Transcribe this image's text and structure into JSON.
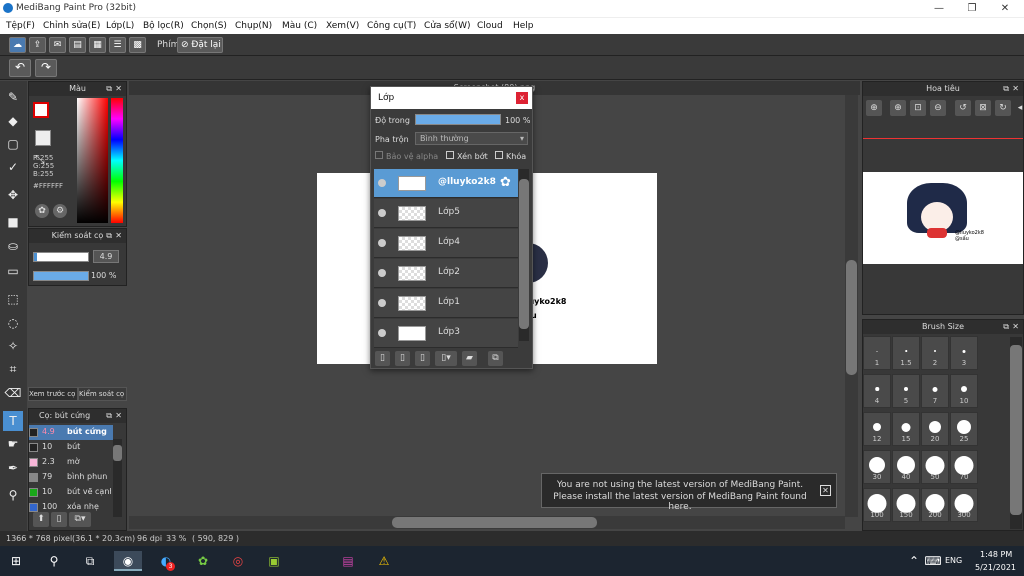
{
  "window": {
    "title": "MediBang Paint Pro (32bit)",
    "min": "—",
    "max": "❐",
    "close": "✕"
  },
  "menu": [
    "Tệp(F)",
    "Chỉnh sửa(E)",
    "Lớp(L)",
    "Bộ lọc(R)",
    "Chọn(S)",
    "Chụp(N)",
    "Màu (C)",
    "Xem(V)",
    "Công cụ(T)",
    "Cửa sổ(W)",
    "Cloud",
    "Help"
  ],
  "toolbar": {
    "shortcut_label": "Phím",
    "reset_label": "Đặt lại",
    "undo": "↶",
    "redo": "↷"
  },
  "color_panel": {
    "title": "Màu",
    "r": "R:255",
    "g": "G:255",
    "b": "B:255",
    "hex": "#FFFFFF"
  },
  "brush_control": {
    "title": "Kiểm soát cọ",
    "size": "4.9",
    "opacity": "100 %"
  },
  "tabs": {
    "preview": "Xem trước cọ",
    "control": "Kiểm soát cọ"
  },
  "brush_list": {
    "title": "Cọ: bút cứng",
    "items": [
      {
        "size": "4.9",
        "name": "bút cứng",
        "color": "#222222"
      },
      {
        "size": "10",
        "name": "bút",
        "color": "#222222"
      },
      {
        "size": "2.3",
        "name": "mờ",
        "color": "#f7b6d8"
      },
      {
        "size": "79",
        "name": "bình phun",
        "color": "#888888"
      },
      {
        "size": "10",
        "name": "bút vẽ cạnh",
        "color": "#1aa81a"
      },
      {
        "size": "100",
        "name": "xóa nhẹ",
        "color": "#3366cc"
      }
    ]
  },
  "document": {
    "tab": "Screenshot (80).png"
  },
  "layer_panel": {
    "title": "Lớp",
    "opacity_label": "Độ trong",
    "opacity_value": "100 %",
    "blend_label": "Pha trộn",
    "blend_value": "Bình thường",
    "protect_alpha": "Bảo vệ alpha",
    "clipping": "Xén bớt",
    "lock": "Khóa",
    "layers": [
      {
        "name": "@lluyko2k8",
        "selected": true
      },
      {
        "name": "Lớp5"
      },
      {
        "name": "Lớp4"
      },
      {
        "name": "Lớp2"
      },
      {
        "name": "Lớp1"
      },
      {
        "name": "Lớp3"
      }
    ]
  },
  "canvas_text": {
    "line1": "lluyko2k8",
    "line2": "u"
  },
  "navigator": {
    "title": "Hoa tiêu",
    "caption": "@lluyko2k8 @sẩu"
  },
  "brush_size": {
    "title": "Brush Size",
    "sizes": [
      "1",
      "1.5",
      "2",
      "3",
      "4",
      "5",
      "7",
      "10",
      "12",
      "15",
      "20",
      "25",
      "30",
      "40",
      "50",
      "70",
      "100",
      "150",
      "200",
      "300"
    ]
  },
  "notification": {
    "line1": "You are not using the latest version of MediBang Paint.",
    "line2": "Please install the latest version of MediBang Paint found here."
  },
  "status": {
    "pixel": "1366 * 768 pixel",
    "cm": "(36.1 * 20.3cm)",
    "dpi": "96 dpi",
    "zoom": "33 %",
    "coords": "( 590, 829 )"
  },
  "taskbar": {
    "lang": "ENG",
    "time": "1:48 PM",
    "date": "5/21/2021",
    "badge": "3"
  }
}
